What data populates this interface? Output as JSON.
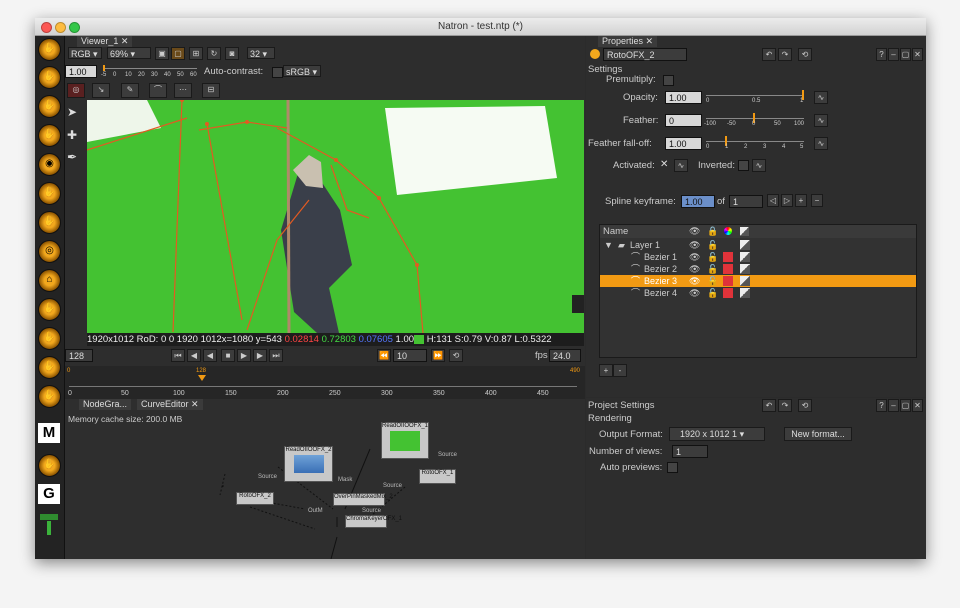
{
  "window": {
    "title": "Natron - test.ntp (*)"
  },
  "left_toolbar": {
    "items": [
      "M",
      "G"
    ]
  },
  "viewer": {
    "tab_label": "Viewer_1",
    "channels": "RGB",
    "zoom": "69%",
    "bit_depth": "32",
    "gain": "1.00",
    "gain_ticks": [
      "-5",
      "0",
      "10",
      "20",
      "30",
      "40",
      "50",
      "60"
    ],
    "autocontrast_label": "Auto-contrast:",
    "colorspace": "sRGB",
    "info_res": "1920x1012",
    "info_rod": "RoD: 0 0 1920 1012",
    "info_xy": "x=1080 y=543",
    "info_r": "0.02814",
    "info_g": "0.72803",
    "info_b": "0.07605",
    "info_a": "1.00",
    "info_hsv": "H:131 S:0.79 V:0.87 L:0.5322",
    "frame": "128",
    "increment": "10",
    "fps_label": "fps",
    "fps": "24.0",
    "timeline_start": "0",
    "timeline_end": "490",
    "timeline_current": "128",
    "timeline_ticks": [
      "0",
      "50",
      "100",
      "150",
      "200",
      "250",
      "300",
      "350",
      "400",
      "450"
    ]
  },
  "bottom_left": {
    "tab_nodegraph": "NodeGra...",
    "tab_curve": "CurveEditor",
    "memory": "Memory cache size: 200.0 MB",
    "nodes": {
      "read1": "ReadOIIOOFX_2",
      "read2": "ReadOIIOOFX_1",
      "roto1": "RotoOFX_2",
      "roto2": "RotoOFX_1",
      "merge": "OverPinMaskedMix_2",
      "keyer": "ChromaKeyerOFX_1"
    },
    "edge_labels": {
      "source1": "Source",
      "mask": "Mask",
      "outm": "OutM",
      "source2": "Source",
      "source3": "Source",
      "source4": "Source"
    }
  },
  "properties": {
    "tab_label": "Properties",
    "node_name": "RotoOFX_2",
    "settings_label": "Settings",
    "premultiply_label": "Premultiply:",
    "opacity_label": "Opacity:",
    "opacity": "1.00",
    "opacity_ticks": [
      "0",
      "0.5",
      "1"
    ],
    "feather_label": "Feather:",
    "feather": "0",
    "feather_ticks": [
      "-100",
      "-50",
      "0",
      "50",
      "100"
    ],
    "falloff_label": "Feather fall-off:",
    "falloff": "1.00",
    "falloff_ticks": [
      "0",
      "1",
      "2",
      "3",
      "4",
      "5"
    ],
    "activated_label": "Activated:",
    "inverted_label": "Inverted:",
    "spline_label": "Spline keyframe:",
    "spline_value": "1.00",
    "spline_of": "of",
    "spline_total": "1",
    "table_header": "Name",
    "layers": [
      {
        "name": "Layer 1",
        "indent": 0
      },
      {
        "name": "Bezier 1",
        "indent": 1
      },
      {
        "name": "Bezier 2",
        "indent": 1
      },
      {
        "name": "Bezier 3",
        "indent": 1
      },
      {
        "name": "Bezier 4",
        "indent": 1
      }
    ],
    "selected_index": 3,
    "add_label": "+",
    "remove_label": "-"
  },
  "project_settings": {
    "title": "Project Settings",
    "rendering_label": "Rendering",
    "output_format_label": "Output Format:",
    "output_format": "1920 x 1012  1",
    "new_format": "New format...",
    "views_label": "Number of views:",
    "views": "1",
    "autopreviews_label": "Auto previews:"
  },
  "colors": {
    "accent": "#f2a81d",
    "green_screen": "#44c232",
    "roto_line": "#e35a22",
    "selected_row": "#f29a13",
    "red_swatch": "#e0333a"
  }
}
